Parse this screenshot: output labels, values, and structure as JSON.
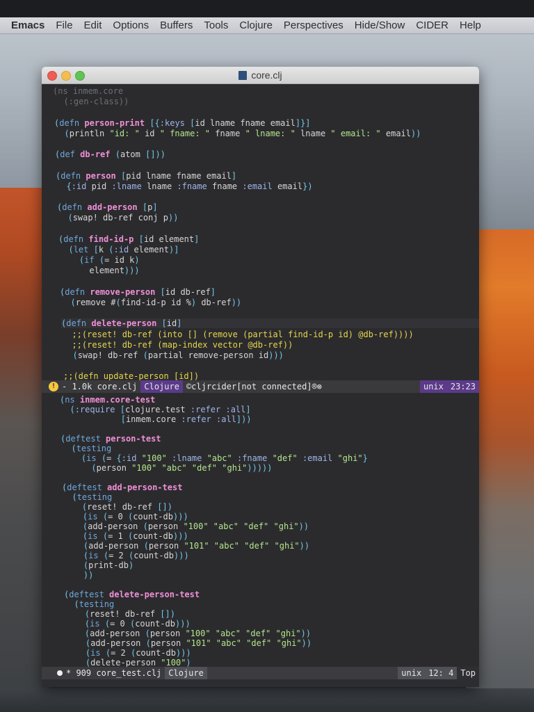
{
  "menubar": {
    "items": [
      "Emacs",
      "File",
      "Edit",
      "Options",
      "Buffers",
      "Tools",
      "Clojure",
      "Perspectives",
      "Hide/Show",
      "CIDER",
      "Help"
    ]
  },
  "window": {
    "title": "core.clj"
  },
  "top_pane": {
    "lines": [
      "(ns inmem.core",
      "  (:gen-class))",
      "",
      "(defn person-print [{:keys [id lname fname email]}]",
      "  (println \"id: \" id \" fname: \" fname \" lname: \" lname \" email: \" email))",
      "",
      "(def db-ref (atom []))",
      "",
      "(defn person [pid lname fname email]",
      "  {:id pid :lname lname :fname fname :email email})",
      "",
      "(defn add-person [p]",
      "  (swap! db-ref conj p))",
      "",
      "(defn find-id-p [id element]",
      "  (let [k (:id element)]",
      "    (if (= id k)",
      "      element)))",
      "",
      "(defn remove-person [id db-ref]",
      "  (remove #(find-id-p id %) db-ref))",
      "",
      "(defn delete-person [id]",
      "  ;;(reset! db-ref (into [] (remove (partial find-id-p id) @db-ref))))",
      "  ;;(reset! db-ref (map-index vector @db-ref))",
      "  (swap! db-ref (partial remove-person id)))",
      "",
      ";;(defn update-person [id])"
    ]
  },
  "top_modeline": {
    "status": "!",
    "size_name": "- 1.0k core.clj",
    "mode": "Clojure",
    "cider": "©cljrcider[not connected]®⊗",
    "encoding": "unix",
    "position": "23:23"
  },
  "bottom_pane": {
    "lines": [
      "(ns inmem.core-test",
      "  (:require [clojure.test :refer :all]",
      "            [inmem.core :refer :all]))",
      "",
      "(deftest person-test",
      "  (testing",
      "    (is (= {:id \"100\" :lname \"abc\" :fname \"def\" :email \"ghi\"}",
      "      (person \"100\" \"abc\" \"def\" \"ghi\")))))",
      "",
      "(deftest add-person-test",
      "  (testing",
      "    (reset! db-ref [])",
      "    (is (= 0 (count-db)))",
      "    (add-person (person \"100\" \"abc\" \"def\" \"ghi\"))",
      "    (is (= 1 (count-db)))",
      "    (add-person (person \"101\" \"abc\" \"def\" \"ghi\"))",
      "    (is (= 2 (count-db)))",
      "    (print-db)",
      "    ))",
      "",
      "(deftest delete-person-test",
      "  (testing",
      "    (reset! db-ref [])",
      "    (is (= 0 (count-db)))",
      "    (add-person (person \"100\" \"abc\" \"def\" \"ghi\"))",
      "    (add-person (person \"101\" \"abc\" \"def\" \"ghi\"))",
      "    (is (= 2 (count-db)))",
      "    (delete-person \"100\")"
    ]
  },
  "bottom_modeline": {
    "size_name": "* 909 core_test.clj",
    "mode": "Clojure",
    "encoding": "unix",
    "position": "12: 4",
    "scroll": "Top"
  },
  "colors": {
    "keyword": "#d98cf0",
    "function_name": "#f08fd6",
    "clojure_keyword": "#9fb6e8",
    "string": "#b5e68a",
    "comment": "#e7d64b",
    "modeline_mode": "#5b3a8a"
  }
}
